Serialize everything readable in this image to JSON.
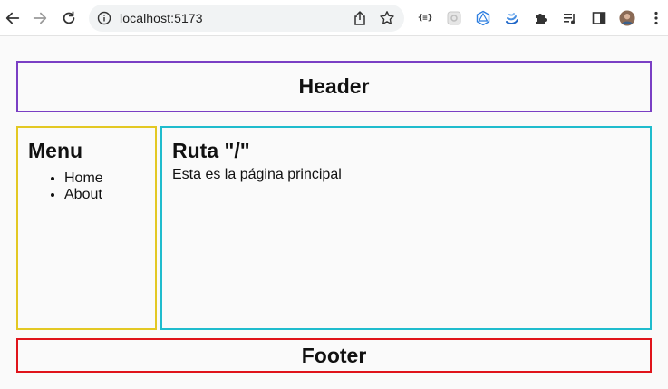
{
  "browser": {
    "url": "localhost:5173"
  },
  "header": {
    "title": "Header"
  },
  "menu": {
    "title": "Menu",
    "items": [
      {
        "label": "Home"
      },
      {
        "label": "About"
      }
    ]
  },
  "main": {
    "title": "Ruta \"/\"",
    "text": "Esta es la página principal"
  },
  "footer": {
    "title": "Footer"
  },
  "colors": {
    "header_border": "#7a3fc4",
    "menu_border": "#e3c823",
    "main_border": "#1fbccd",
    "footer_border": "#e0141b"
  },
  "icons": {
    "back": "arrow-left-icon",
    "forward": "arrow-right-icon",
    "reload": "reload-icon",
    "site_info": "info-icon",
    "share": "share-icon",
    "bookmark": "star-icon",
    "extensions": [
      "json-formatter-icon",
      "ext-square-icon",
      "graphql-icon",
      "ext-wave-icon",
      "puzzle-icon",
      "media-icon",
      "side-panel-icon",
      "avatar",
      "kebab-menu-icon"
    ]
  }
}
